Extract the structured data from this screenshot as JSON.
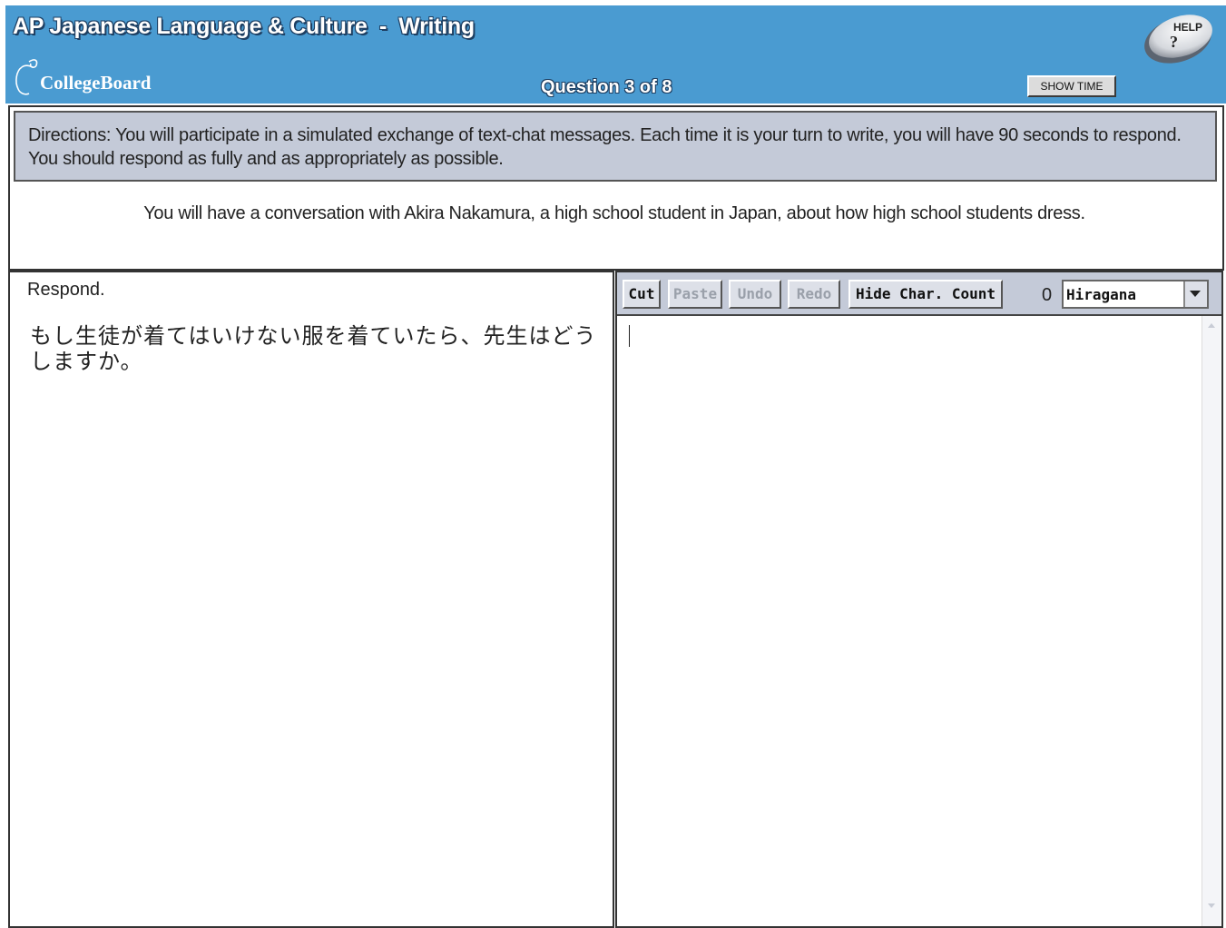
{
  "header": {
    "title": "AP Japanese Language & Culture  -  Writing",
    "logo_text": "CollegeBoard",
    "question_counter": "Question 3 of 8",
    "show_time_label": "SHOW TIME",
    "help_label": "HELP",
    "help_symbol": "?"
  },
  "directions": {
    "text": "Directions: You will participate in a simulated exchange of text-chat messages. Each time it is your turn to write, you will have 90 seconds to respond. You should respond as fully and as appropriately as possible.",
    "prompt": "You will have a conversation with Akira Nakamura, a high school student in Japan, about how high school students dress."
  },
  "question_panel": {
    "respond_label": "Respond.",
    "question_text": "もし生徒が着てはいけない服を着ていたら、先生はどうしますか。"
  },
  "answer_panel": {
    "toolbar": {
      "cut_label": "Cut",
      "paste_label": "Paste",
      "undo_label": "Undo",
      "redo_label": "Redo",
      "hide_char_count_label": "Hide Char. Count",
      "char_count": "0",
      "input_mode": "Hiragana"
    },
    "response_text": ""
  },
  "colors": {
    "header_blue": "#4a9bd1",
    "panel_gray_blue": "#c4cad8"
  },
  "icons": [
    "apple-logo-icon",
    "help-icon",
    "dropdown-arrow-icon",
    "scroll-up-icon",
    "scroll-down-icon"
  ]
}
